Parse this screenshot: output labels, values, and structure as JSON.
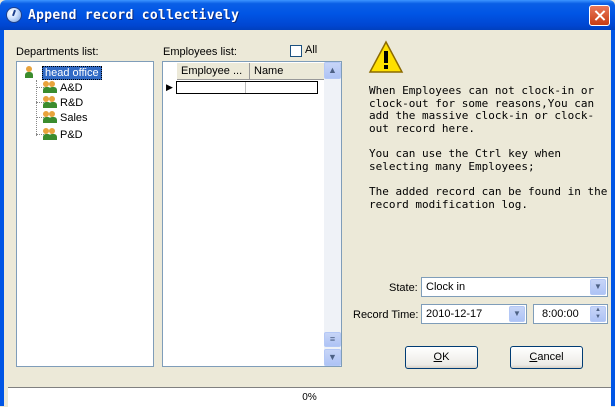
{
  "window": {
    "title": "Append record collectively"
  },
  "departments": {
    "label": "Departments list:",
    "root": "head office",
    "items": [
      "A&D",
      "R&D",
      "Sales",
      "P&D"
    ]
  },
  "employees": {
    "label": "Employees list:",
    "all_label": "All",
    "all_checked": false,
    "columns": [
      "Employee ...",
      "Name"
    ],
    "row_indicator": "▶"
  },
  "message": {
    "p1": "When Employees can not clock-in or clock-out for some reasons,You can add the massive clock-in or clock-out record here.",
    "p2": "You can use the Ctrl key when selecting many Employees;",
    "p3": "The added record can be found in the record modification log."
  },
  "form": {
    "state_label": "State:",
    "state_value": "Clock in",
    "record_time_label": "Record Time:",
    "date_value": "2010-12-17",
    "time_value": "8:00:00"
  },
  "buttons": {
    "ok_key": "O",
    "ok_rest": "K",
    "cancel_key": "C",
    "cancel_rest": "ancel"
  },
  "status": {
    "progress_text": "0%",
    "progress": 0
  },
  "colors": {
    "titlebar": "#0055E5",
    "selection": "#316AC5",
    "dialog_bg": "#ECE9D8"
  }
}
